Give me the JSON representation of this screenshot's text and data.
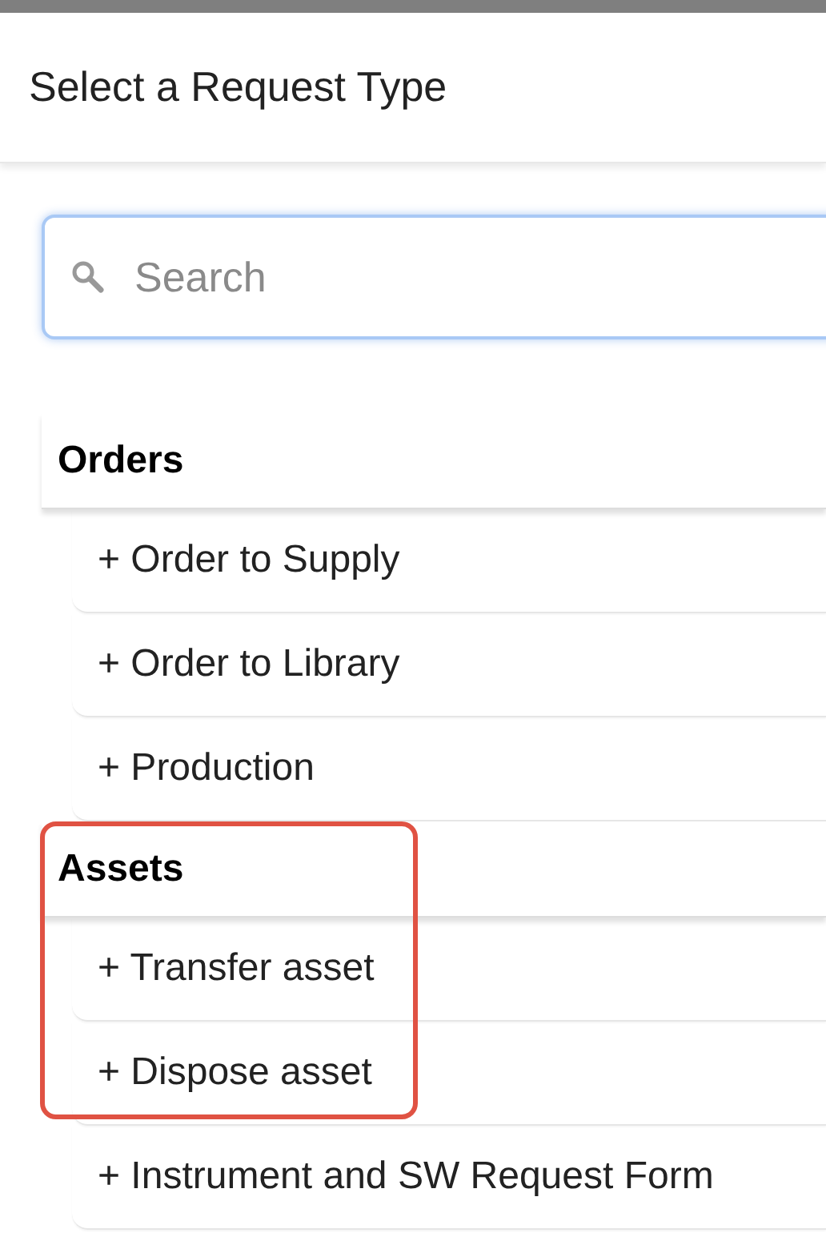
{
  "dialog": {
    "title": "Select a Request Type"
  },
  "search": {
    "placeholder": "Search",
    "focused": true
  },
  "groups": [
    {
      "title": "Orders",
      "items": [
        {
          "label": "+ Order to Supply",
          "highlighted": false
        },
        {
          "label": "+ Order to Library",
          "highlighted": false
        },
        {
          "label": "+ Production",
          "highlighted": false
        }
      ]
    },
    {
      "title": "Assets",
      "items": [
        {
          "label": "+ Transfer asset",
          "highlighted": true
        },
        {
          "label": "+ Dispose asset",
          "highlighted": true
        },
        {
          "label": "+ Instrument and SW Request Form",
          "highlighted": false
        }
      ]
    }
  ]
}
